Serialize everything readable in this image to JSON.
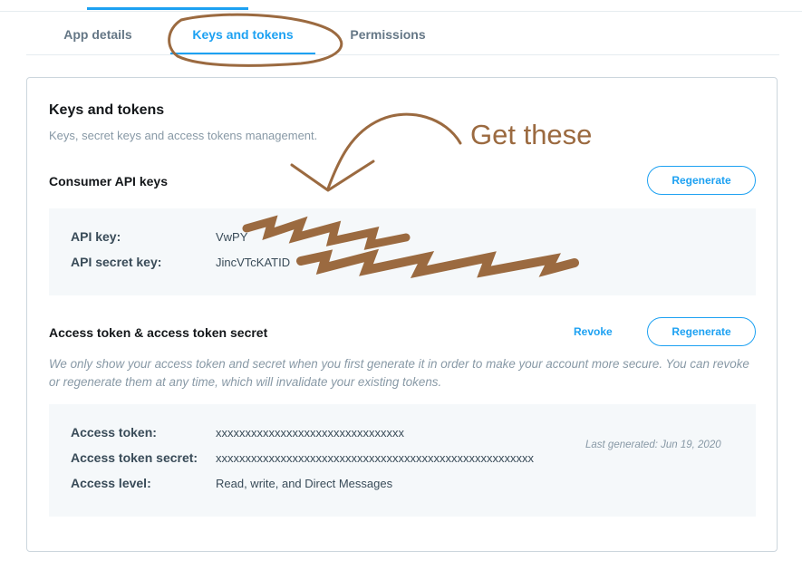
{
  "tabs": [
    {
      "label": "App details",
      "active": false
    },
    {
      "label": "Keys and tokens",
      "active": true
    },
    {
      "label": "Permissions",
      "active": false
    }
  ],
  "page": {
    "title": "Keys and tokens",
    "subtitle": "Keys, secret keys and access tokens management."
  },
  "consumer": {
    "title": "Consumer API keys",
    "regenerate_label": "Regenerate",
    "rows": [
      {
        "label": "API key:",
        "value": "VwPY"
      },
      {
        "label": "API secret key:",
        "value": "JincVTcKATID"
      }
    ]
  },
  "access": {
    "title": "Access token & access token secret",
    "revoke_label": "Revoke",
    "regenerate_label": "Regenerate",
    "note": "We only show your access token and secret when you first generate it in order to make your account more secure. You can revoke or regenerate them at any time, which will invalidate your existing tokens.",
    "rows": [
      {
        "label": "Access token:",
        "value": "xxxxxxxxxxxxxxxxxxxxxxxxxxxxxxxx"
      },
      {
        "label": "Access token secret:",
        "value": "xxxxxxxxxxxxxxxxxxxxxxxxxxxxxxxxxxxxxxxxxxxxxxxxxxxxxx"
      },
      {
        "label": "Access level:",
        "value": "Read, write, and Direct Messages"
      }
    ],
    "last_generated": "Last generated: Jun 19, 2020"
  },
  "annotation": {
    "text": "Get these",
    "color": "#9b6a40"
  },
  "colors": {
    "accent": "#1da1f2",
    "panel_bg": "#f5f8fa",
    "border": "#ccd6dd"
  }
}
